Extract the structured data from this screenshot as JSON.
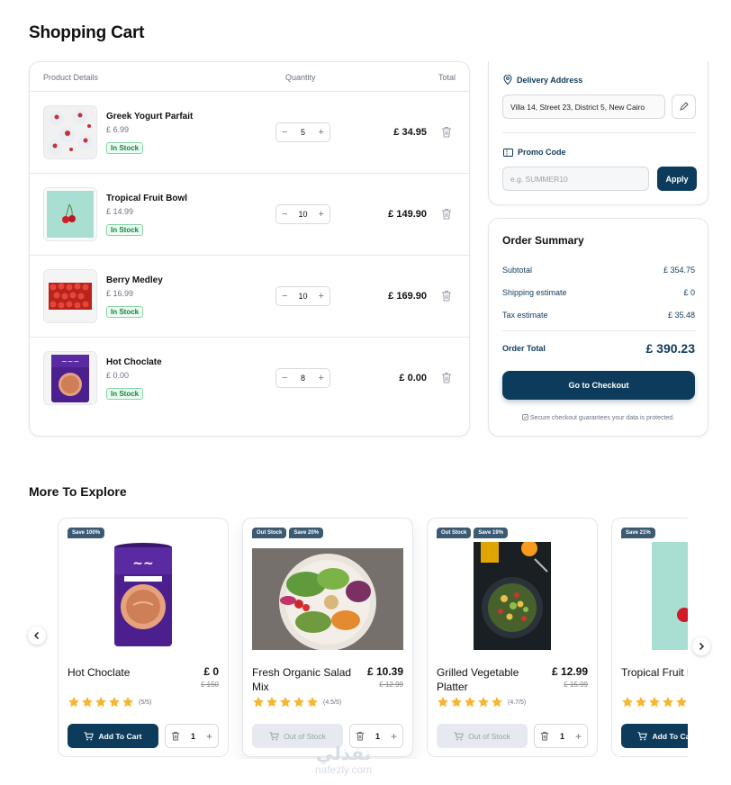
{
  "page": {
    "title": "Shopping Cart"
  },
  "cart": {
    "headers": {
      "product": "Product Details",
      "quantity": "Quantity",
      "total": "Total"
    },
    "items": [
      {
        "name": "Greek Yogurt Parfait",
        "price": "£ 6.99",
        "stock": "In Stock",
        "qty": "5",
        "total": "£ 34.95"
      },
      {
        "name": "Tropical Fruit Bowl",
        "price": "£ 14.99",
        "stock": "In Stock",
        "qty": "10",
        "total": "£ 149.90"
      },
      {
        "name": "Berry Medley",
        "price": "£ 16.99",
        "stock": "In Stock",
        "qty": "10",
        "total": "£ 169.90"
      },
      {
        "name": "Hot Choclate",
        "price": "£ 0.00",
        "stock": "In Stock",
        "qty": "8",
        "total": "£ 0.00"
      }
    ],
    "minus": "−",
    "plus": "+"
  },
  "delivery": {
    "label": "Delivery Address",
    "address": "Villa 14, Street 23, District 5, New Cairo",
    "promo_label": "Promo Code",
    "promo_placeholder": "e.g. SUMMER10",
    "apply": "Apply"
  },
  "summary": {
    "title": "Order Summary",
    "subtotal_label": "Subtotal",
    "subtotal": "£ 354.75",
    "shipping_label": "Shipping estimate",
    "shipping": "£ 0",
    "tax_label": "Tax estimate",
    "tax": "£ 35.48",
    "total_label": "Order Total",
    "total": "£ 390.23",
    "checkout": "Go to Checkout",
    "secure": "Secure checkout guarantees your data is protected."
  },
  "explore": {
    "title": "More To Explore",
    "products": [
      {
        "badges": [
          "Save 100%"
        ],
        "name": "Hot Choclate",
        "price": "£ 0",
        "old_price": "£ 150",
        "rating": "(5/5)",
        "button": "Add To Cart",
        "button_disabled": false,
        "qty": "1"
      },
      {
        "badges": [
          "Out Stock",
          "Save 20%"
        ],
        "name": "Fresh Organic Salad Mix",
        "price": "£ 10.39",
        "old_price": "£ 12.99",
        "rating": "(4.5/5)",
        "button": "Out of Stock",
        "button_disabled": true,
        "qty": "1"
      },
      {
        "badges": [
          "Out Stock",
          "Save 19%"
        ],
        "name": "Grilled Vegetable Platter",
        "price": "£ 12.99",
        "old_price": "£ 15.99",
        "rating": "(4.7/5)",
        "button": "Out of Stock",
        "button_disabled": true,
        "qty": "1"
      },
      {
        "badges": [
          "Save 21%"
        ],
        "name": "Tropical Fruit Bowl",
        "price": "",
        "old_price": "",
        "rating": "",
        "button": "Add To Cart",
        "button_disabled": false,
        "qty": ""
      }
    ]
  },
  "watermark": {
    "arabic": "نفذلي",
    "latin": "nafezly.com"
  },
  "colors": {
    "primary": "#0d3b5c",
    "star": "#f5b731",
    "stock_green": "#15803d"
  }
}
